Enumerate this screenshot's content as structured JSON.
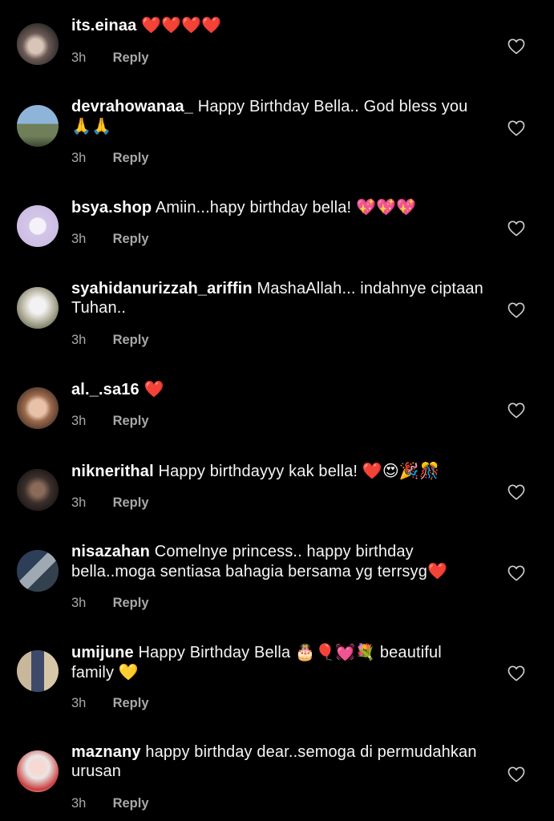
{
  "colors": {
    "background": "#000000",
    "text": "#f5f5f5",
    "muted": "#a8a8a8"
  },
  "comments": [
    {
      "username": "its.einaa",
      "text": "",
      "emoji": "❤️❤️❤️❤️",
      "emoji_after": "",
      "time": "3h",
      "reply": "Reply",
      "icon": "heart-outline-icon"
    },
    {
      "username": "devrahowanaa_",
      "text": "Happy Birthday Bella.. God bless you",
      "emoji": "🙏🙏",
      "emoji_after": "",
      "time": "3h",
      "reply": "Reply",
      "icon": "heart-outline-icon"
    },
    {
      "username": "bsya.shop",
      "text": "Amiin...hapy birthday bella!",
      "emoji": "💖💖💖",
      "emoji_after": "",
      "time": "3h",
      "reply": "Reply",
      "icon": "heart-outline-icon"
    },
    {
      "username": "syahidanurizzah_ariffin",
      "text": "MashaAllah... indahnye ciptaan Tuhan..",
      "emoji": "",
      "emoji_after": "",
      "time": "3h",
      "reply": "Reply",
      "icon": "heart-outline-icon"
    },
    {
      "username": "al._.sa16",
      "text": "",
      "emoji": "❤️",
      "emoji_after": "",
      "time": "3h",
      "reply": "Reply",
      "icon": "heart-outline-icon"
    },
    {
      "username": "niknerithal",
      "text": "Happy birthdayyy kak bella!",
      "emoji": "❤️😍🎉🎊",
      "emoji_after": "",
      "time": "3h",
      "reply": "Reply",
      "icon": "heart-outline-icon"
    },
    {
      "username": "nisazahan",
      "text": "Comelnye princess.. happy birthday bella..moga sentiasa bahagia bersama yg terrsyg",
      "emoji": "❤️",
      "emoji_after": "",
      "time": "3h",
      "reply": "Reply",
      "icon": "heart-outline-icon"
    },
    {
      "username": "umijune",
      "text": "Happy Birthday Bella",
      "emoji": "🎂🎈💓💐",
      "emoji_after": "beautiful family",
      "emoji_tail": "💛",
      "time": "3h",
      "reply": "Reply",
      "icon": "heart-outline-icon"
    },
    {
      "username": "maznany",
      "text": "happy birthday dear..semoga di permudahkan urusan",
      "emoji": "",
      "emoji_after": "",
      "time": "3h",
      "reply": "Reply",
      "icon": "heart-outline-icon"
    }
  ]
}
